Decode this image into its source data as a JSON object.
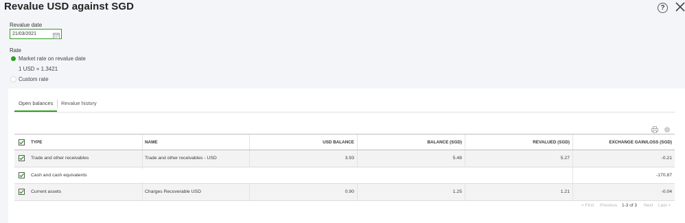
{
  "dialog": {
    "title": "Revalue USD against SGD",
    "help_icon": "help-circle-icon",
    "help_glyph": "?",
    "close_icon": "close-icon"
  },
  "revalue_date": {
    "label": "Revalue date",
    "value": "21/03/2021",
    "icon": "calendar-icon"
  },
  "rate": {
    "label": "Rate",
    "options": [
      {
        "label": "Market rate on revalue date",
        "selected": true
      },
      {
        "label": "Custom rate",
        "selected": false
      }
    ],
    "market_rate_text": "1 USD = 1.3421"
  },
  "tabs": [
    {
      "label": "Open balances",
      "active": true
    },
    {
      "label": "Revalue history",
      "active": false
    }
  ],
  "toolbar": {
    "print_icon": "printer-icon",
    "settings_icon": "gear-icon"
  },
  "table": {
    "columns": [
      "TYPE",
      "NAME",
      "USD BALANCE",
      "BALANCE (SGD)",
      "REVALUED (SGD)",
      "EXCHANGE GAIN/LOSS (SGD)"
    ],
    "rows": [
      {
        "checked": true,
        "type": "Trade and other receivables",
        "name": "Trade and other receivables - USD",
        "usd_balance": "3.93",
        "balance_sgd": "5.48",
        "revalued_sgd": "5.27",
        "gain_loss": "-0.21"
      },
      {
        "checked": true,
        "type": "Cash and cash equivalents",
        "name": "",
        "usd_balance": "",
        "balance_sgd": "",
        "revalued_sgd": "",
        "gain_loss": "-170.87"
      },
      {
        "checked": true,
        "type": "Current assets",
        "name": "Charges Recoverable USD",
        "usd_balance": "0.90",
        "balance_sgd": "1.25",
        "revalued_sgd": "1.21",
        "gain_loss": "-0.04"
      }
    ]
  },
  "pagination": {
    "first": "< First",
    "previous": "Previous",
    "range": "1-3 of 3",
    "next": "Next",
    "last": "Last >"
  },
  "colors": {
    "accent": "#2ca01c",
    "page_bg": "#f4f5f8",
    "row_tint": "#f3f3f3"
  }
}
